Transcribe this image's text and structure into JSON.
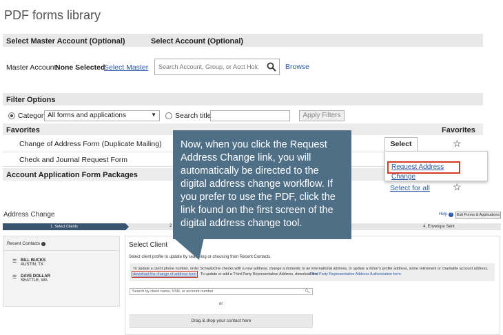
{
  "page_title": "PDF forms library",
  "account_bar": {
    "master_heading": "Select Master Account (Optional)",
    "account_heading": "Select Account (Optional)"
  },
  "master_account": {
    "label": "Master Account:",
    "value": "None Selected",
    "select_link": "Select Master",
    "search_placeholder": "Search Account, Group, or Acct Holder",
    "browse_link": "Browse"
  },
  "filter_options": {
    "heading": "Filter Options",
    "category_label": "Category",
    "category_value": "All forms and applications",
    "search_titles_label": "Search titles",
    "apply_button": "Apply Filters"
  },
  "favorites": {
    "heading": "Favorites",
    "column_label": "Favorites",
    "items": [
      {
        "name": "Change of Address Form (Duplicate Mailing)"
      },
      {
        "name": "Check and Journal Request Form"
      }
    ],
    "select_button": "Select",
    "dropdown_link": "Request Address Change",
    "select_all_link": "Select for all"
  },
  "account_packages": {
    "heading": "Account Application Form Packages"
  },
  "tooltip_text": "Now, when you click the Request Address Change link, you will automatically be directed to the digital address change workflow. If you prefer to use the PDF, click the link found on the first screen of the digital address change tool.",
  "address_change": {
    "title": "Address Change",
    "help_link": "Help",
    "exit_button": "Exit Forms & Applications",
    "steps": {
      "step1": "1. Select Clients",
      "step2": "2",
      "step4": "4. Envelope Sent"
    },
    "recent_contacts": {
      "heading": "Recent Contacts",
      "contacts": [
        {
          "name": "BILL BUCKS",
          "location": "AUSTIN, TX"
        },
        {
          "name": "DAVE DOLLAR",
          "location": "SEATTLE, WA"
        }
      ]
    },
    "select_client": {
      "heading": "Select Client",
      "instruction": "Select client profile to update by searching or choosing from Recent Contacts.",
      "info_line1": "To update a client phone number, order SchwabOne checks with a new address, change a domestic to an international address, or update a minor's profile address, some retirement or charitable account address,",
      "info_link1": "download the change of address form",
      "info_mid": "To update or add a Third Party Representative Address, download the",
      "info_link2": "Third Party Representative Address Authorization form",
      "search_placeholder": "Search by client name, SSN, or account number",
      "or_text": "or",
      "drag_text": "Drag & drop your contact here"
    }
  },
  "colors": {
    "tooltip_bg": "#4f6f87",
    "highlight_red": "#d33b25",
    "link_blue": "#2a57a8",
    "step_active": "#3b5570"
  }
}
